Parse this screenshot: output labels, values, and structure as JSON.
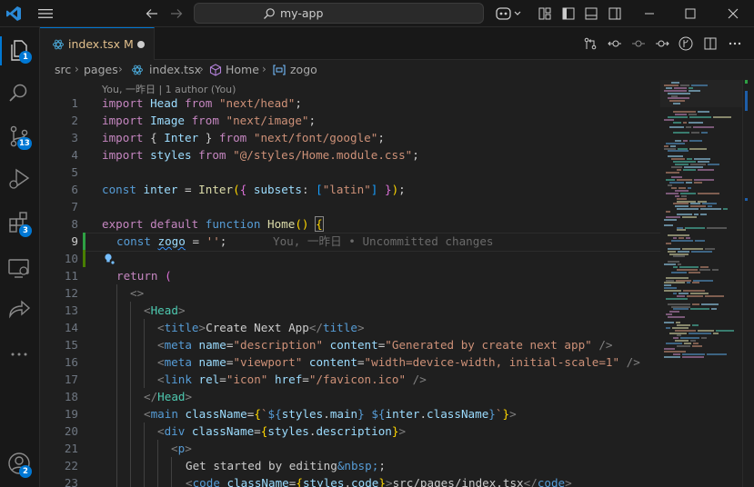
{
  "titlebar": {
    "search_label": "my-app"
  },
  "activity": {
    "explorer_badge": "1",
    "scm_badge": "13",
    "extensions_badge": "3",
    "accounts_badge": "2"
  },
  "tab": {
    "filename": "index.tsx",
    "status": "M"
  },
  "breadcrumb": {
    "items": [
      "src",
      "pages",
      "index.tsx",
      "Home",
      "zogo"
    ]
  },
  "codelens": "You, 一昨日 | 1 author (You)",
  "blame": "You, 一昨日 • Uncommitted changes",
  "line_numbers": [
    "1",
    "2",
    "3",
    "4",
    "5",
    "6",
    "7",
    "8",
    "9",
    "10",
    "11",
    "12",
    "13",
    "14",
    "15",
    "16",
    "17",
    "18",
    "19",
    "20",
    "21",
    "22",
    "23"
  ],
  "code": {
    "l1": {
      "kw1": "import",
      "id": " Head ",
      "kw2": "from",
      "sp": " ",
      "str": "\"next/head\"",
      "end": ";"
    },
    "l2": {
      "kw1": "import",
      "id": " Image ",
      "kw2": "from",
      "sp": " ",
      "str": "\"next/image\"",
      "end": ";"
    },
    "l3": {
      "kw1": "import",
      "a": " { ",
      "id": "Inter",
      "b": " } ",
      "kw2": "from",
      "sp": " ",
      "str": "\"next/font/google\"",
      "end": ";"
    },
    "l4": {
      "kw1": "import",
      "id": " styles ",
      "kw2": "from",
      "sp": " ",
      "str": "\"@/styles/Home.module.css\"",
      "end": ";"
    },
    "l6": {
      "kw": "const",
      "v": " inter",
      "eq": " = ",
      "fn": "Inter",
      "p1": "(",
      "b1": "{",
      "key": " subsets",
      "col": ": ",
      "b2": "[",
      "str": "\"latin\"",
      "b2c": "]",
      "b1c": " }",
      "p1c": ")",
      "end": ";"
    },
    "l8": {
      "k1": "export",
      "k2": " default",
      "k3": " function",
      "fn": " Home",
      "p": "()",
      "sp": " ",
      "br": "{"
    },
    "l9": {
      "kw": "const",
      "sp": " ",
      "v": "zogo",
      "eq": " = ",
      "str": "''",
      "end": ";"
    },
    "l11": {
      "k": "return",
      "p": " ("
    },
    "l12": {
      "t": "<>"
    },
    "l13": {
      "o": "<",
      "t": "Head",
      "c": ">"
    },
    "l14": {
      "o": "<",
      "t": "title",
      "c": ">",
      "txt": "Create Next App",
      "o2": "</",
      "t2": "title",
      "c2": ">"
    },
    "l15": {
      "o": "<",
      "t": "meta",
      "a1": " name",
      "eq1": "=",
      "s1": "\"description\"",
      "a2": " content",
      "eq2": "=",
      "s2": "\"Generated by create next app\"",
      "c": " />"
    },
    "l16": {
      "o": "<",
      "t": "meta",
      "a1": " name",
      "eq1": "=",
      "s1": "\"viewport\"",
      "a2": " content",
      "eq2": "=",
      "s2": "\"width=device-width, initial-scale=1\"",
      "c": " />"
    },
    "l17": {
      "o": "<",
      "t": "link",
      "a1": " rel",
      "eq1": "=",
      "s1": "\"icon\"",
      "a2": " href",
      "eq2": "=",
      "s2": "\"/favicon.ico\"",
      "c": " />"
    },
    "l18": {
      "o": "</",
      "t": "Head",
      "c": ">"
    },
    "l19": {
      "o": "<",
      "t": "main",
      "a": " className",
      "eq": "=",
      "b": "{",
      "bt": "`",
      "d1": "${",
      "v1": "styles",
      "dot1": ".",
      "p1": "main",
      "e1": "}",
      "sp": " ",
      "d2": "${",
      "v2": "inter",
      "dot2": ".",
      "p2": "className",
      "e2": "}",
      "bt2": "`",
      "bc": "}",
      "c": ">"
    },
    "l20": {
      "o": "<",
      "t": "div",
      "a": " className",
      "eq": "=",
      "b": "{",
      "v": "styles",
      "dot": ".",
      "p": "description",
      "bc": "}",
      "c": ">"
    },
    "l21": {
      "o": "<",
      "t": "p",
      "c": ">"
    },
    "l22": {
      "txt": "Get started by editing",
      "ent": "&nbsp;"
    },
    "l23": {
      "o": "<",
      "t": "code",
      "a": " className",
      "eq": "=",
      "b": "{",
      "v": "styles",
      "dot": ".",
      "p": "code",
      "bc": "}",
      "c": ">",
      "txt": "src/pages/index.tsx",
      "o2": "</",
      "t2": "code",
      "c2": ">"
    }
  },
  "colors": {
    "accent": "#0078d4",
    "modified_tab": "#e2c08d",
    "gutter_modified": "#2ea043"
  }
}
